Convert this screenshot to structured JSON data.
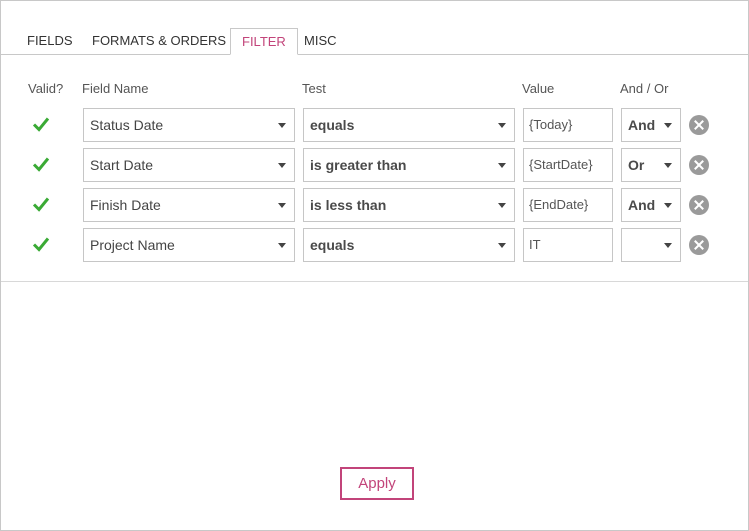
{
  "tabs": [
    {
      "label": "FIELDS",
      "active": false
    },
    {
      "label": "FORMATS & ORDERS",
      "active": false
    },
    {
      "label": "FILTER",
      "active": true
    },
    {
      "label": "MISC",
      "active": false
    }
  ],
  "columns": {
    "valid": "Valid?",
    "field_name": "Field Name",
    "test": "Test",
    "value": "Value",
    "and_or": "And / Or"
  },
  "rows": [
    {
      "valid": true,
      "field": "Status Date",
      "test": "equals",
      "value": "{Today}",
      "and_or": "And"
    },
    {
      "valid": true,
      "field": "Start Date",
      "test": "is greater than",
      "value": "{StartDate}",
      "and_or": "Or"
    },
    {
      "valid": true,
      "field": "Finish Date",
      "test": "is less than",
      "value": "{EndDate}",
      "and_or": "And"
    },
    {
      "valid": true,
      "field": "Project Name",
      "test": "equals",
      "value": "IT",
      "and_or": ""
    }
  ],
  "apply_label": "Apply",
  "colors": {
    "accent": "#c2447a",
    "valid_check": "#3aaa35",
    "remove_icon": "#9a9a9a"
  },
  "icons": {
    "valid": "check-icon",
    "remove": "remove-circle-icon",
    "dropdown": "chevron-down-icon"
  }
}
